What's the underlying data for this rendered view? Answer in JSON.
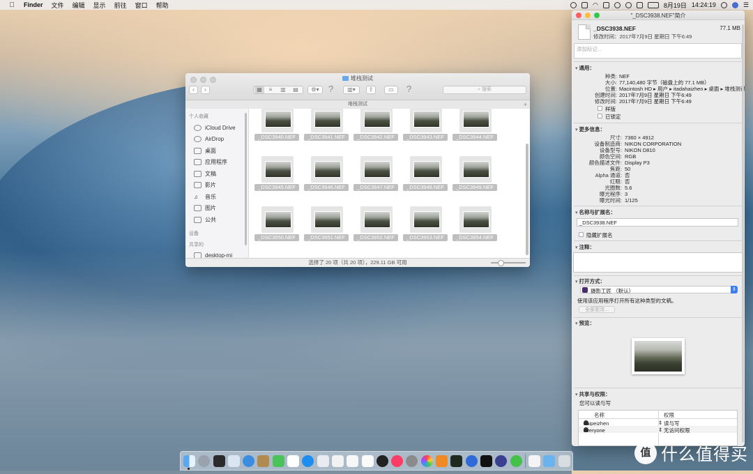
{
  "menubar": {
    "apple": "",
    "app_name": "Finder",
    "items": [
      "文件",
      "编辑",
      "显示",
      "前往",
      "窗口",
      "帮助"
    ],
    "date": "8月19日",
    "time": "14:24:19"
  },
  "finder": {
    "title": "堆栈测试",
    "path_title": "堆栈测试",
    "search_placeholder": "搜索",
    "sidebar": {
      "favorites_header": "个人收藏",
      "favorites": [
        "iCloud Drive",
        "AirDrop",
        "桌面",
        "应用程序",
        "文稿",
        "影片",
        "音乐",
        "图片",
        "公共"
      ],
      "devices_header": "设备",
      "shared_header": "共享的",
      "shared": [
        "desktop-mi"
      ]
    },
    "files": [
      "_DSC3940.NEF",
      "_DSC3941.NEF",
      "_DSC3942.NEF",
      "_DSC3943.NEF",
      "_DSC3944.NEF",
      "_DSC3945.NEF",
      "_DSC3946.NEF",
      "_DSC3947.NEF",
      "_DSC3948.NEF",
      "_DSC3949.NEF",
      "_DSC3950.NEF",
      "_DSC3951.NEF",
      "_DSC3952.NEF",
      "_DSC3953.NEF",
      "_DSC3954.NEF"
    ],
    "status": "选择了 20 项（共 20 项），229.11 GB 可用"
  },
  "info": {
    "title": "\"_DSC3938.NEF\"简介",
    "name": "_DSC3938.NEF",
    "size": "77.1 MB",
    "modified_line": "修改时间：2017年7月9日 星期日 下午6:49",
    "tags_placeholder": "添加标记...",
    "general": {
      "header": "通用：",
      "kind_k": "种类:",
      "kind_v": "NEF",
      "size_k": "大小:",
      "size_v": "77,140,480 字节（磁盘上的 77.1 MB）",
      "where_k": "位置:",
      "where_v": "Macintosh HD ▸ 用户 ▸ itadahaizhen ▸ 桌面 ▸ 堆栈测试",
      "created_k": "创建时间:",
      "created_v": "2017年7月9日 星期日 下午6:49",
      "modified_k": "修改时间:",
      "modified_v": "2017年7月9日 星期日 下午6:49",
      "stationery": "样版",
      "locked": "已锁定"
    },
    "more": {
      "header": "更多信息：",
      "rows": [
        {
          "k": "尺寸:",
          "v": "7360 × 4912"
        },
        {
          "k": "设备制造商:",
          "v": "NIKON CORPORATION"
        },
        {
          "k": "设备型号:",
          "v": "NIKON D810"
        },
        {
          "k": "颜色空间:",
          "v": "RGB"
        },
        {
          "k": "颜色描述文件:",
          "v": "Display P3"
        },
        {
          "k": "焦距:",
          "v": "50"
        },
        {
          "k": "Alpha 通道:",
          "v": "否"
        },
        {
          "k": "红眼:",
          "v": "否"
        },
        {
          "k": "光圈数:",
          "v": "5.6"
        },
        {
          "k": "曝光程序:",
          "v": "3"
        },
        {
          "k": "曝光时间:",
          "v": "1/125"
        }
      ]
    },
    "name_ext": {
      "header": "名称与扩展名：",
      "value": "_DSC3938.NEF",
      "hide_ext": "隐藏扩展名"
    },
    "comments_header": "注释：",
    "open_with": {
      "header": "打开方式：",
      "app": "摄影工匠 （默认）",
      "desc": "使用该应用程序打开所有这种类型的文稿。",
      "change_all": "全部更改..."
    },
    "preview_header": "预览：",
    "sharing": {
      "header": "共享与权限：",
      "desc": "您可以读与写",
      "col_name": "名称",
      "col_priv": "权限",
      "rows": [
        {
          "name": "daipeizhen（本用户）",
          "priv": "读与写"
        },
        {
          "name": "everyone",
          "priv": "无访问权限"
        }
      ]
    }
  },
  "watermark": {
    "badge": "值",
    "text": "什么值得买"
  }
}
